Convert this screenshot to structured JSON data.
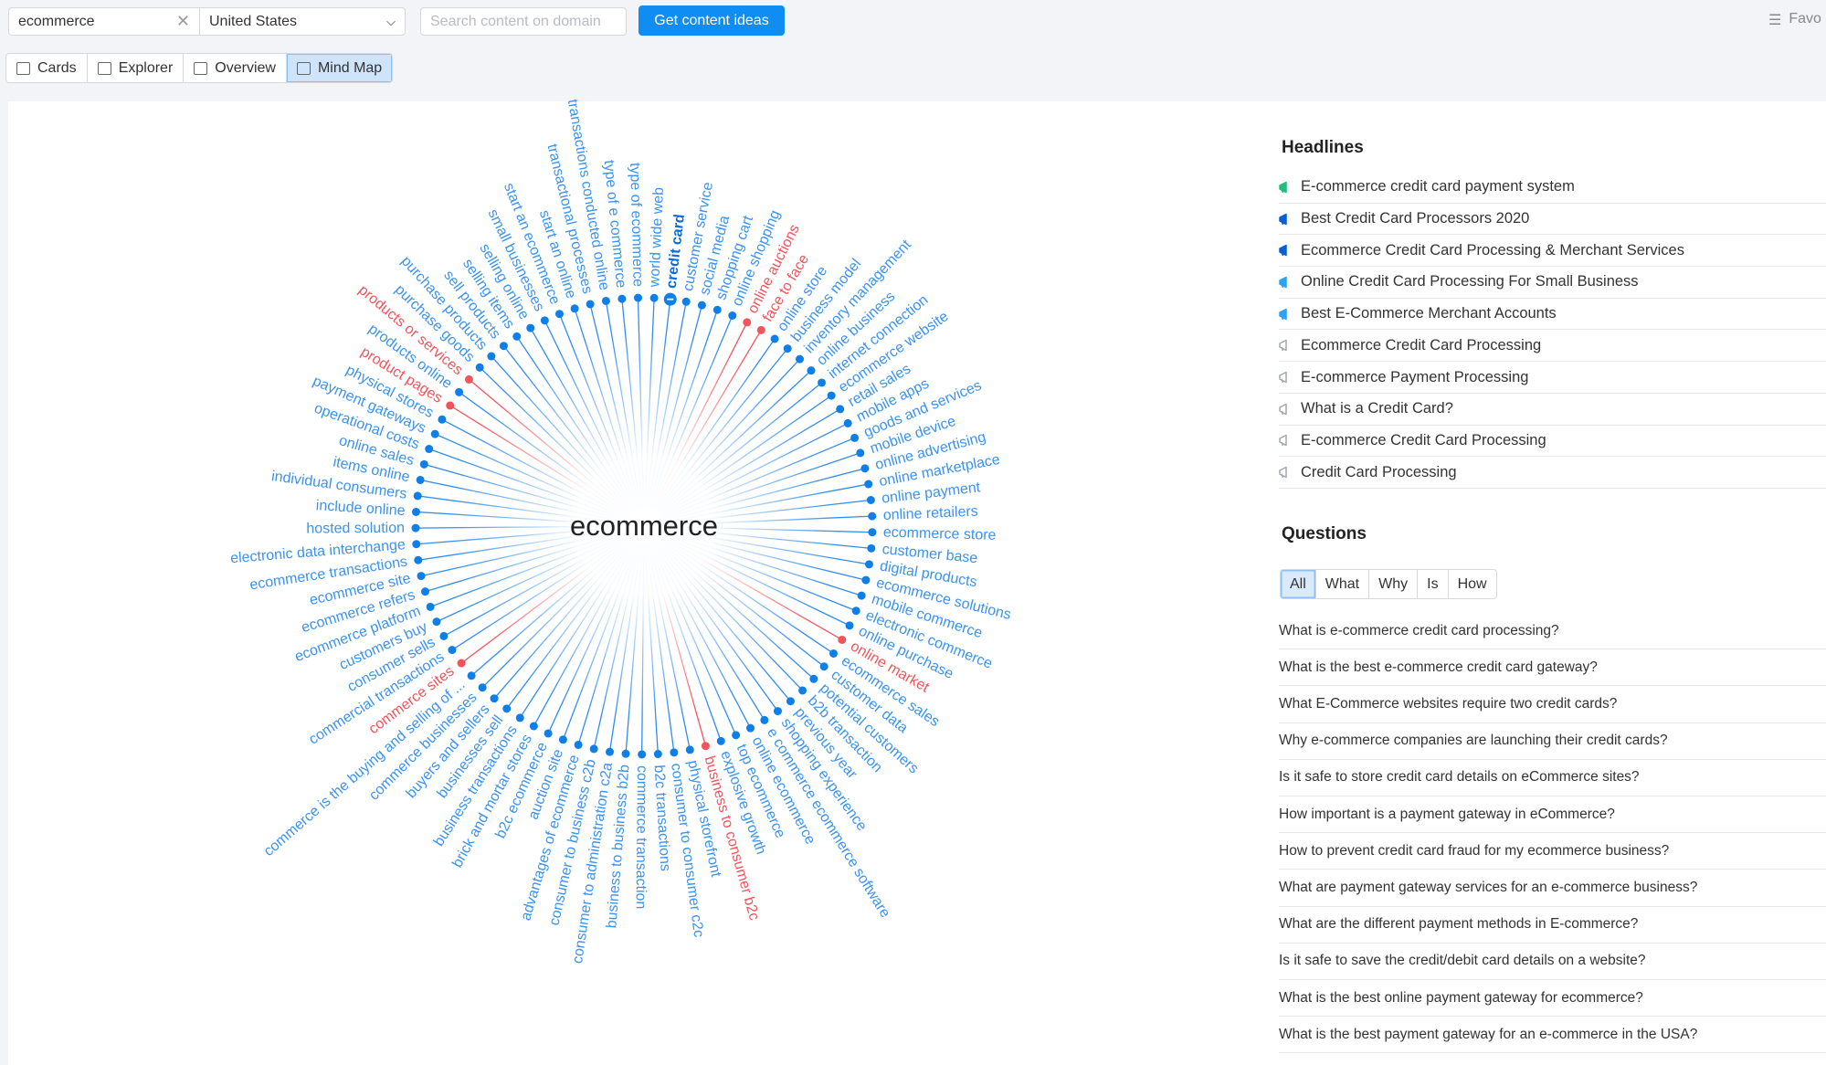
{
  "search": {
    "keyword": "ecommerce",
    "country": "United States",
    "domain_placeholder": "Search content on domain",
    "submit_label": "Get content ideas"
  },
  "favorites_label": "Favo",
  "tabs": [
    {
      "label": "Cards",
      "icon": "cards-icon"
    },
    {
      "label": "Explorer",
      "icon": "table-icon"
    },
    {
      "label": "Overview",
      "icon": "overview-icon"
    },
    {
      "label": "Mind Map",
      "icon": "mind-map-icon",
      "active": true
    }
  ],
  "colors": {
    "accent": "#0f8df2",
    "node_blue": "#3b93f0",
    "node_red": "#f2545b",
    "green": "#1fbf7a",
    "dark_blue": "#0b5fd0",
    "light_blue": "#2ea3f2",
    "gray": "#a3a7ae"
  },
  "mindmap": {
    "center": "ecommerce",
    "selected": "credit card",
    "nodes": [
      {
        "t": "credit card",
        "sel": true
      },
      {
        "t": "customer service"
      },
      {
        "t": "social media"
      },
      {
        "t": "shopping cart"
      },
      {
        "t": "online shopping"
      },
      {
        "t": "online auctions",
        "red": true
      },
      {
        "t": "face to face",
        "red": true
      },
      {
        "t": "online store"
      },
      {
        "t": "business model"
      },
      {
        "t": "inventory management"
      },
      {
        "t": "online business"
      },
      {
        "t": "internet connection"
      },
      {
        "t": "ecommerce website"
      },
      {
        "t": "retail sales"
      },
      {
        "t": "mobile apps"
      },
      {
        "t": "goods and services"
      },
      {
        "t": "mobile device"
      },
      {
        "t": "online advertising"
      },
      {
        "t": "online marketplace"
      },
      {
        "t": "online payment"
      },
      {
        "t": "online retailers"
      },
      {
        "t": "ecommerce store"
      },
      {
        "t": "customer base"
      },
      {
        "t": "digital products"
      },
      {
        "t": "ecommerce solutions"
      },
      {
        "t": "mobile commerce"
      },
      {
        "t": "electronic commerce"
      },
      {
        "t": "online purchase"
      },
      {
        "t": "online market",
        "red": true
      },
      {
        "t": "ecommerce sales"
      },
      {
        "t": "customer data"
      },
      {
        "t": "potential customers"
      },
      {
        "t": "b2b transaction"
      },
      {
        "t": "previous year"
      },
      {
        "t": "shopping experience"
      },
      {
        "t": "e commerce ecommerce software"
      },
      {
        "t": "online ecommerce"
      },
      {
        "t": "top ecommerce"
      },
      {
        "t": "explosive growth"
      },
      {
        "t": "business to consumer b2c",
        "red": true
      },
      {
        "t": "physical storefront"
      },
      {
        "t": "consumer to consumer c2c"
      },
      {
        "t": "b2c transactions"
      },
      {
        "t": "commerce transaction"
      },
      {
        "t": "business to business b2b"
      },
      {
        "t": "consumer to administration c2a"
      },
      {
        "t": "consumer to business c2b"
      },
      {
        "t": "advantages of ecommerce"
      },
      {
        "t": "auction site"
      },
      {
        "t": "b2c ecommerce"
      },
      {
        "t": "brick and mortar stores"
      },
      {
        "t": "business transactions"
      },
      {
        "t": "businesses sell"
      },
      {
        "t": "buyers and sellers"
      },
      {
        "t": "commerce businesses"
      },
      {
        "t": "commerce is the buying and selling of ..."
      },
      {
        "t": "commerce sites",
        "red": true
      },
      {
        "t": "commercial transactions"
      },
      {
        "t": "consumer sells"
      },
      {
        "t": "customers buy"
      },
      {
        "t": "ecommerce platform"
      },
      {
        "t": "ecommerce refers"
      },
      {
        "t": "ecommerce site"
      },
      {
        "t": "ecommerce transactions"
      },
      {
        "t": "electronic data interchange"
      },
      {
        "t": "hosted solution"
      },
      {
        "t": "include online"
      },
      {
        "t": "individual consumers"
      },
      {
        "t": "items online"
      },
      {
        "t": "online sales"
      },
      {
        "t": "operational costs"
      },
      {
        "t": "payment gateways"
      },
      {
        "t": "physical stores"
      },
      {
        "t": "product pages",
        "red": true
      },
      {
        "t": "products online"
      },
      {
        "t": "products or services",
        "red": true
      },
      {
        "t": "purchase goods"
      },
      {
        "t": "purchase products"
      },
      {
        "t": "sell products"
      },
      {
        "t": "selling items"
      },
      {
        "t": "selling online"
      },
      {
        "t": "small businesses"
      },
      {
        "t": "start an ecommerce"
      },
      {
        "t": "start an online"
      },
      {
        "t": "transactional processes"
      },
      {
        "t": "transactions conducted online"
      },
      {
        "t": "type of e commerce"
      },
      {
        "t": "type of ecommerce"
      },
      {
        "t": "world wide web"
      }
    ]
  },
  "headlines": {
    "title": "Headlines",
    "items": [
      {
        "text": "E-commerce credit card payment system",
        "level": "green"
      },
      {
        "text": "Best Credit Card Processors 2020",
        "level": "dark_blue"
      },
      {
        "text": "Ecommerce Credit Card Processing & Merchant Services",
        "level": "dark_blue"
      },
      {
        "text": "Online Credit Card Processing For Small Business",
        "level": "light_blue"
      },
      {
        "text": "Best E-Commerce Merchant Accounts",
        "level": "light_blue"
      },
      {
        "text": "Ecommerce Credit Card Processing",
        "level": "gray"
      },
      {
        "text": "E-commerce Payment Processing",
        "level": "gray"
      },
      {
        "text": "What is a Credit Card?",
        "level": "gray"
      },
      {
        "text": "E-commerce Credit Card Processing",
        "level": "gray"
      },
      {
        "text": "Credit Card Processing",
        "level": "gray"
      }
    ]
  },
  "questions": {
    "title": "Questions",
    "filters": [
      "All",
      "What",
      "Why",
      "Is",
      "How"
    ],
    "active_filter": "All",
    "items": [
      "What is e-commerce credit card processing?",
      "What is the best e-commerce credit card gateway?",
      "What E-Commerce websites require two credit cards?",
      "Why e-commerce companies are launching their credit cards?",
      "Is it safe to store credit card details on eCommerce sites?",
      "How important is a payment gateway in eCommerce?",
      "How to prevent credit card fraud for my ecommerce business?",
      "What are payment gateway services for an e-commerce business?",
      "What are the different payment methods in E-commerce?",
      "Is it safe to save the credit/debit card details on a website?",
      "What is the best online payment gateway for ecommerce?",
      "What is the best payment gateway for an e-commerce in the USA?"
    ]
  }
}
